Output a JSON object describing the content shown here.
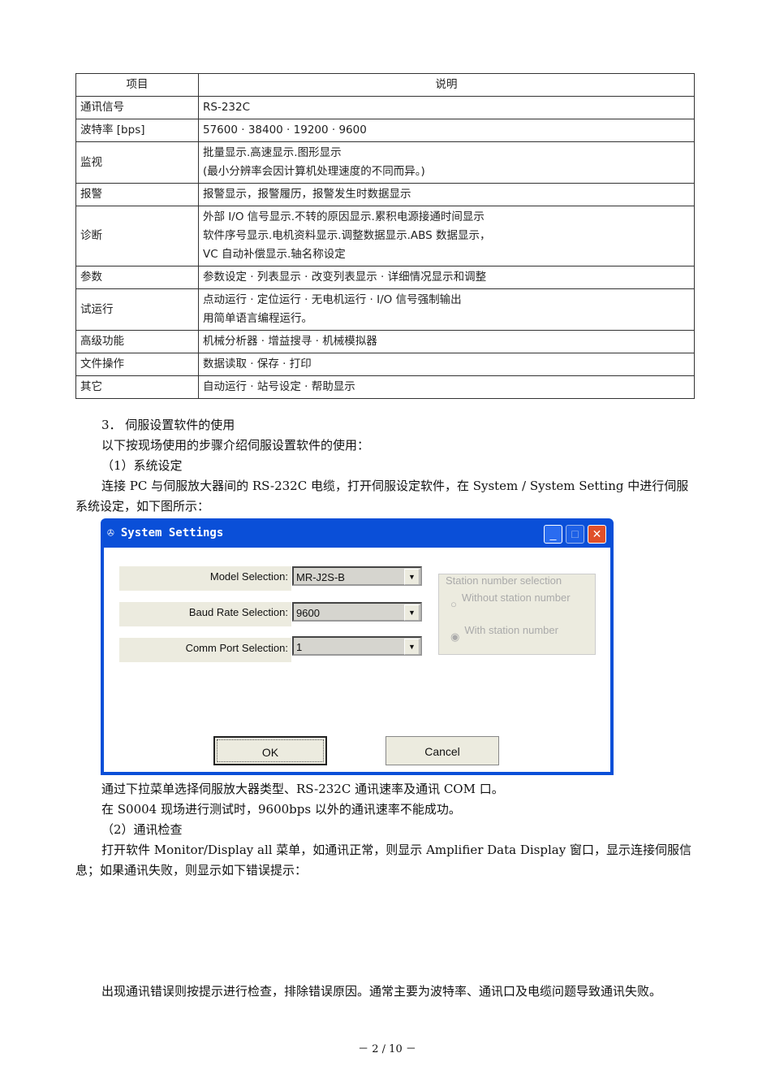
{
  "table": {
    "headers": [
      "项目",
      "说明"
    ],
    "rows": [
      {
        "item": "通讯信号",
        "desc": [
          "RS-232C"
        ]
      },
      {
        "item": "波特率 [bps]",
        "desc": [
          "57600 · 38400 · 19200 · 9600"
        ]
      },
      {
        "item": "监视",
        "desc": [
          "批量显示.高速显示.图形显示",
          "(最小分辨率会因计算机处理速度的不同而异。)"
        ]
      },
      {
        "item": "报警",
        "desc": [
          "报警显示，报警履历，报警发生时数据显示"
        ]
      },
      {
        "item": "诊断",
        "desc": [
          "外部 I/O 信号显示.不转的原因显示.累积电源接通时间显示",
          "软件序号显示.电机资料显示.调整数据显示.ABS 数据显示，",
          "VC 自动补偿显示.轴名称设定"
        ]
      },
      {
        "item": "参数",
        "desc": [
          "参数设定 · 列表显示 · 改变列表显示 · 详细情况显示和调整"
        ]
      },
      {
        "item": "试运行",
        "desc": [
          "点动运行 · 定位运行 · 无电机运行 · I/O 信号强制输出",
          "用简单语言编程运行。"
        ]
      },
      {
        "item": "高级功能",
        "desc": [
          "机械分析器 · 增益搜寻 · 机械模拟器"
        ]
      },
      {
        "item": "文件操作",
        "desc": [
          "数据读取 · 保存 ·  打印"
        ]
      },
      {
        "item": "其它",
        "desc": [
          "自动运行 · 站号设定 · 帮助显示"
        ]
      }
    ]
  },
  "text": {
    "s3": "3．  伺服设置软件的使用",
    "intro": "以下按现场使用的步骤介绍伺服设置软件的使用：",
    "step1": "（1）系统设定",
    "step1_desc": "连接 PC 与伺服放大器间的 RS-232C 电缆，打开伺服设定软件，在 System / System Setting 中进行伺服系统设定，如下图所示：",
    "after1": "通过下拉菜单选择伺服放大器类型、RS-232C 通讯速率及通讯 COM 口。",
    "after2": "在 S0004 现场进行测试时，9600bps 以外的通讯速率不能成功。",
    "step2": "（2）通讯检查",
    "step2_desc": "打开软件 Monitor/Display all 菜单，如通讯正常，则显示 Amplifier Data Display 窗口，显示连接伺服信息；如果通讯失败，则显示如下错误提示：",
    "final": "出现通讯错误则按提示进行检查，排除错误原因。通常主要为波特率、通讯口及电缆问题导致通讯失败。",
    "footer": "－ 2 / 10 －"
  },
  "dialog": {
    "title": "System Settings",
    "model_label": "Model Selection:",
    "model_value": "MR-J2S-B",
    "baud_label": "Baud Rate Selection:",
    "baud_value": "9600",
    "port_label": "Comm Port Selection:",
    "port_value": "1",
    "station_group": "Station number selection",
    "opt1": "Without station number",
    "opt2": "With station number",
    "ok": "OK",
    "cancel": "Cancel"
  }
}
